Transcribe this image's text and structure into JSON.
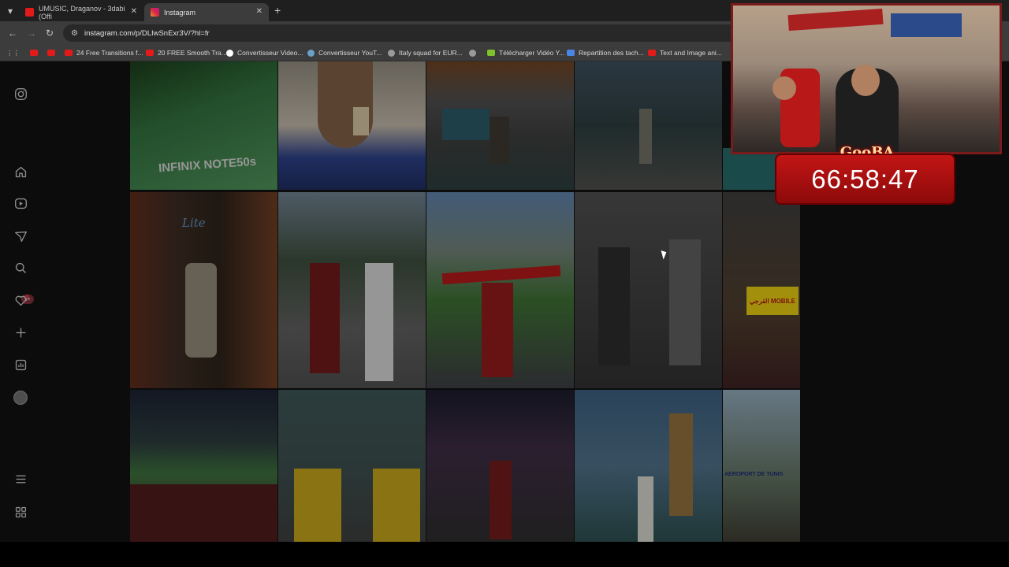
{
  "browser": {
    "tabs": [
      {
        "title": "UMUSIC, Draganov - 3dabi (Offi",
        "favicon": "youtube-icon",
        "color": "#e31a1a"
      },
      {
        "title": "Instagram",
        "favicon": "instagram-icon",
        "color": "#d6249f"
      }
    ],
    "url": "instagram.com/p/DLIwSnExr3V/?hl=fr",
    "bookmarks": [
      {
        "label": "",
        "icon": "youtube-icon"
      },
      {
        "label": "",
        "icon": "youtube-icon"
      },
      {
        "label": "24 Free Transitions f...",
        "icon": "youtube-icon"
      },
      {
        "label": "20 FREE Smooth Tra...",
        "icon": "youtube-icon"
      },
      {
        "label": "Convertisseur Video...",
        "icon": "google-icon"
      },
      {
        "label": "Convertisseur YouT...",
        "icon": "globe-icon"
      },
      {
        "label": "Italy squad for EUR...",
        "icon": "globe-icon"
      },
      {
        "label": "",
        "icon": "globe-icon"
      },
      {
        "label": "Télécharger Vidéo Y...",
        "icon": "download-icon"
      },
      {
        "label": "Repartition des tach...",
        "icon": "docs-icon"
      },
      {
        "label": "Text and Image ani...",
        "icon": "youtube-icon"
      }
    ]
  },
  "sidebar": {
    "icons": [
      "instagram-icon",
      "home-icon",
      "reels-icon",
      "messages-icon",
      "search-icon",
      "notifications-icon",
      "create-icon",
      "dashboard-icon",
      "profile-avatar",
      "menu-icon",
      "more-icon"
    ],
    "messages_badge": "9+"
  },
  "grid": {
    "row1": [
      "post-1",
      "post-2",
      "post-3",
      "post-4"
    ],
    "row2": [
      "post-5",
      "post-6",
      "post-7",
      "post-8",
      "post-9"
    ],
    "row3": [
      "post-10",
      "post-11",
      "post-12",
      "post-13",
      "post-14"
    ],
    "captions": {
      "post1": "INFINIX NOTE50s",
      "post5": "Lite",
      "post9": "القرجي MOBILE",
      "post14": "AEROPORT DE TUNIS"
    }
  },
  "overlay": {
    "logo": "GooBA",
    "timer": "66:58:47"
  }
}
